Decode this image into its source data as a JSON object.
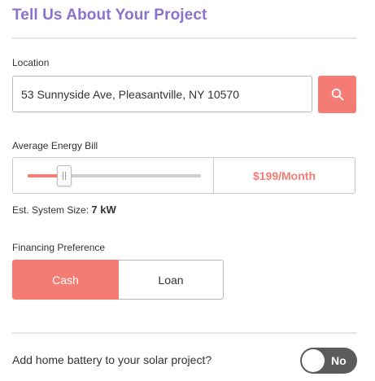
{
  "header": {
    "title": "Tell Us About Your Project"
  },
  "location": {
    "label": "Location",
    "value": "53 Sunnyside Ave, Pleasantville, NY 10570",
    "search_icon": "search-icon"
  },
  "energy_bill": {
    "label": "Average Energy Bill",
    "display": "$199/Month",
    "slider_fraction": 0.21
  },
  "system_size": {
    "label": "Est. System Size:",
    "value": "7 kW"
  },
  "financing": {
    "label": "Financing Preference",
    "options": [
      "Cash",
      "Loan"
    ],
    "selected": "Cash"
  },
  "battery": {
    "label": "Add home battery to your solar project?",
    "toggle_text": "No"
  },
  "colors": {
    "accent": "#f47c74",
    "title": "#8a72cf",
    "toggle_off": "#5b5b5b"
  }
}
